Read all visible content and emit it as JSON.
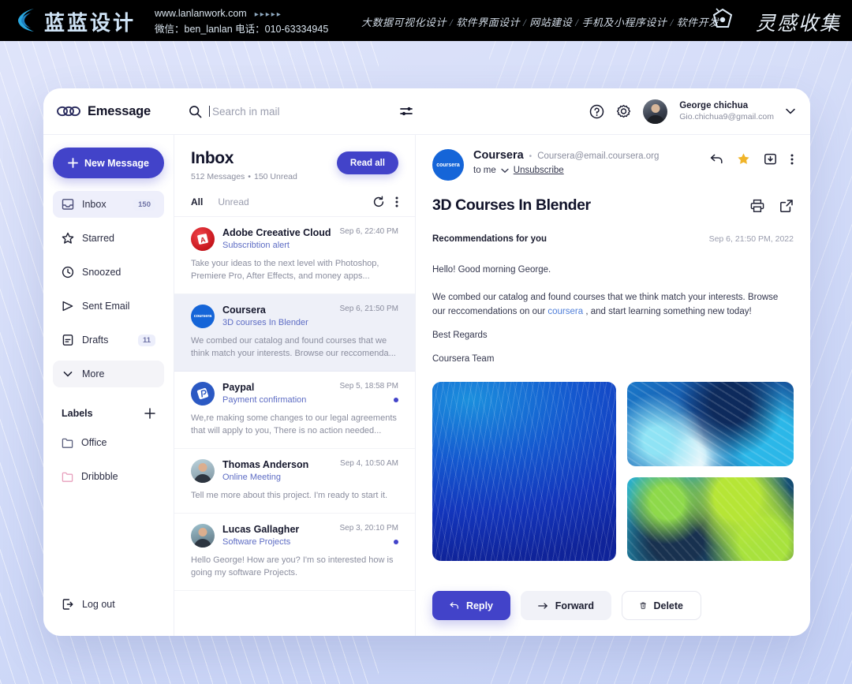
{
  "ad_banner": {
    "logo_text": "蓝蓝设计",
    "website": "www.lanlanwork.com",
    "dots": "▸▸▸▸▸",
    "contact": "微信：ben_lanlan    电话：010-63334945",
    "services": [
      "大数据可视化设计",
      "软件界面设计",
      "网站建设",
      "手机及小程序设计",
      "软件开发"
    ],
    "right_text": "灵感收集"
  },
  "topbar": {
    "brand_name": "Emessage",
    "search_placeholder": "Search in mail",
    "user_name": "George chichua",
    "user_email": "Gio.chichua9@gmail.com"
  },
  "sidebar": {
    "new_message_label": "New Message",
    "items": [
      {
        "label": "Inbox",
        "badge": "150",
        "icon": "inbox-icon"
      },
      {
        "label": "Starred",
        "badge": "",
        "icon": "star-icon"
      },
      {
        "label": "Snoozed",
        "badge": "",
        "icon": "clock-icon"
      },
      {
        "label": "Sent Email",
        "badge": "",
        "icon": "send-icon"
      },
      {
        "label": "Drafts",
        "badge": "11",
        "icon": "draft-icon"
      },
      {
        "label": "More",
        "badge": "",
        "icon": "chevron-down-icon"
      }
    ],
    "labels_title": "Labels",
    "labels": [
      {
        "label": "Office",
        "color": "#5a5f7d"
      },
      {
        "label": "Dribbble",
        "color": "#e8a0bd"
      }
    ],
    "logout_label": "Log out"
  },
  "list": {
    "title": "Inbox",
    "messages_count": "512 Messages",
    "unread_count": "150 Unread",
    "read_all_label": "Read all",
    "tabs": [
      {
        "label": "All",
        "active": true
      },
      {
        "label": "Unread",
        "active": false
      }
    ],
    "items": [
      {
        "sender": "Adobe Creeative Cloud",
        "subject": "Subscribtion alert",
        "date": "Sep 6, 22:40 PM",
        "preview": "Take your ideas to the next level with Photoshop, Premiere Pro, After Effects, and money apps...",
        "unread": false,
        "selected": false,
        "avatar": "adobe-logo"
      },
      {
        "sender": "Coursera",
        "subject": "3D courses In Blender",
        "date": "Sep 6, 21:50 PM",
        "preview": "We combed our catalog and found courses that we think match your interests. Browse our reccomenda...",
        "unread": false,
        "selected": true,
        "avatar": "coursera-logo"
      },
      {
        "sender": "Paypal",
        "subject": "Payment confirmation",
        "date": "Sep 5, 18:58 PM",
        "preview": "We,re making some changes to our legal agreements that will apply to you, There is no action needed...",
        "unread": true,
        "selected": false,
        "avatar": "paypal-logo"
      },
      {
        "sender": "Thomas Anderson",
        "subject": "Online Meeting",
        "date": "Sep 4, 10:50 AM",
        "preview": "Tell me more about this project. I'm ready to start it.",
        "unread": false,
        "selected": false,
        "avatar": "user-photo"
      },
      {
        "sender": "Lucas Gallagher",
        "subject": "Software Projects",
        "date": "Sep 3, 20:10 PM",
        "preview": "Hello George! How are you? I'm so interested how is going my software Projects.",
        "unread": true,
        "selected": false,
        "avatar": "user-photo"
      }
    ]
  },
  "detail": {
    "sender": "Coursera",
    "sender_email": "Coursera@email.coursera.org",
    "separator": "•",
    "to_label": "to me",
    "unsubscribe_label": "Unsubscribe",
    "avatar_text": "coursera",
    "title": "3D Courses In Blender",
    "section_label": "Recommendations for you",
    "date": "Sep 6, 21:50 PM, 2022",
    "greeting": "Hello! Good morning George.",
    "body_part1": "We combed our catalog and found courses that we think match your interests. Browse our reccomendations on our ",
    "body_link": "coursera",
    "body_part2": " , and start learning something new today!",
    "sign_off": "Best Regards",
    "signature": "Coursera Team",
    "buttons": {
      "reply": "Reply",
      "forward": "Forward",
      "delete": "Delete"
    }
  },
  "colors": {
    "accent": "#4243c9",
    "link": "#4f7ed8",
    "star": "#f0b429",
    "subject": "#5d6cc4",
    "background": "#c9d4f5"
  }
}
